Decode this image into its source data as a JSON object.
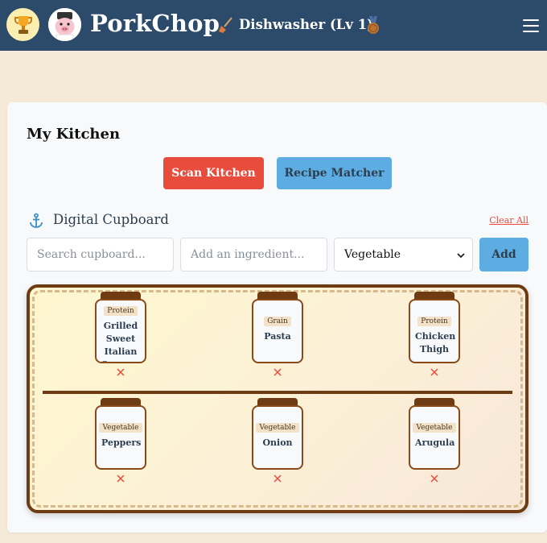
{
  "header": {
    "brand": "PorkChop",
    "rank": "Dishwasher (Lv 1)",
    "icons": {
      "trophy": "trophy-icon",
      "avatar": "chef-pig-avatar",
      "rank": "broom-icon",
      "medal": "medal-icon",
      "menu": "hamburger-menu-icon"
    },
    "colors": {
      "bar": "#2c4a6a",
      "text": "#ffffff"
    }
  },
  "kitchen": {
    "title": "My Kitchen",
    "scan_button": "Scan Kitchen",
    "matcher_button": "Recipe Matcher"
  },
  "cupboard": {
    "title": "Digital Cupboard",
    "clear_all": "Clear All",
    "search_placeholder": "Search cupboard...",
    "ingredient_placeholder": "Add an ingredient...",
    "category_selected": "Vegetable",
    "add_button": "Add",
    "shelves": [
      [
        {
          "category": "Protein",
          "name": "Grilled Sweet Italian Sausage"
        },
        {
          "category": "Grain",
          "name": "Pasta"
        },
        {
          "category": "Protein",
          "name": "Chicken Thigh"
        }
      ],
      [
        {
          "category": "Vegetable",
          "name": "Peppers"
        },
        {
          "category": "Vegetable",
          "name": "Onion"
        },
        {
          "category": "Vegetable",
          "name": "Arugula"
        }
      ]
    ]
  },
  "colors": {
    "accent_red": "#e74c3c",
    "accent_blue": "#5dade2",
    "wood": "#6e3b12"
  }
}
